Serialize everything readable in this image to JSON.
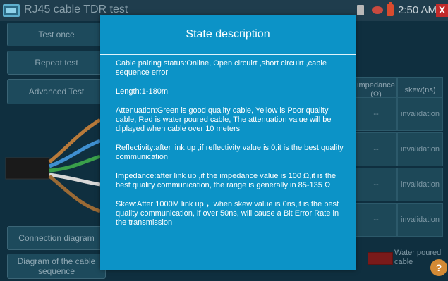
{
  "header": {
    "title": "RJ45 cable TDR test",
    "time": "2:50 AM",
    "close_label": "X",
    "icons": [
      "sd-card-icon",
      "eye-icon",
      "battery-icon",
      "close-icon"
    ]
  },
  "menu": {
    "test_once": "Test once",
    "repeat_test": "Repeat test",
    "advanced_test": "Advanced Test",
    "connection_diagram": "Connection diagram",
    "diagram_cable_sequence": "Diagram of the cable sequence"
  },
  "table": {
    "headers": {
      "impedance": "impedance (Ω)",
      "skew": "skew(ns)"
    },
    "rows": [
      {
        "impedance": "--",
        "skew": "invalidation"
      },
      {
        "impedance": "--",
        "skew": "invalidation"
      },
      {
        "impedance": "--",
        "skew": "invalidation"
      },
      {
        "impedance": "--",
        "skew": "invalidation"
      }
    ]
  },
  "legend": {
    "label": "Water poured cable",
    "color": "#7a1a1a"
  },
  "help_label": "?",
  "modal": {
    "title": "State description",
    "paragraphs": [
      "Cable pairing status:Online, Open circuirt ,short circuirt ,cable sequence error",
      "Length:1-180m",
      "Attenuation:Green is good quality cable, Yellow is Poor quality cable, Red is water poured cable, The attenuation value will be diplayed when cable over 10 meters",
      "Reflectivity:after link up ,if reflectivity value is 0,it is the best quality communication",
      "Impedance:after link up ,if the impedance value is 100 Ω,it is the best quality communication, the range is generally in 85-135 Ω",
      "Skew:After 1000M link up ，when skew value is 0ns,it is the best quality communication, if over 50ns, will cause a Bit Error Rate in the transmission"
    ]
  },
  "colors": {
    "modal_bg": "#0c93c7",
    "screen_bg": "#0f2f3f"
  }
}
